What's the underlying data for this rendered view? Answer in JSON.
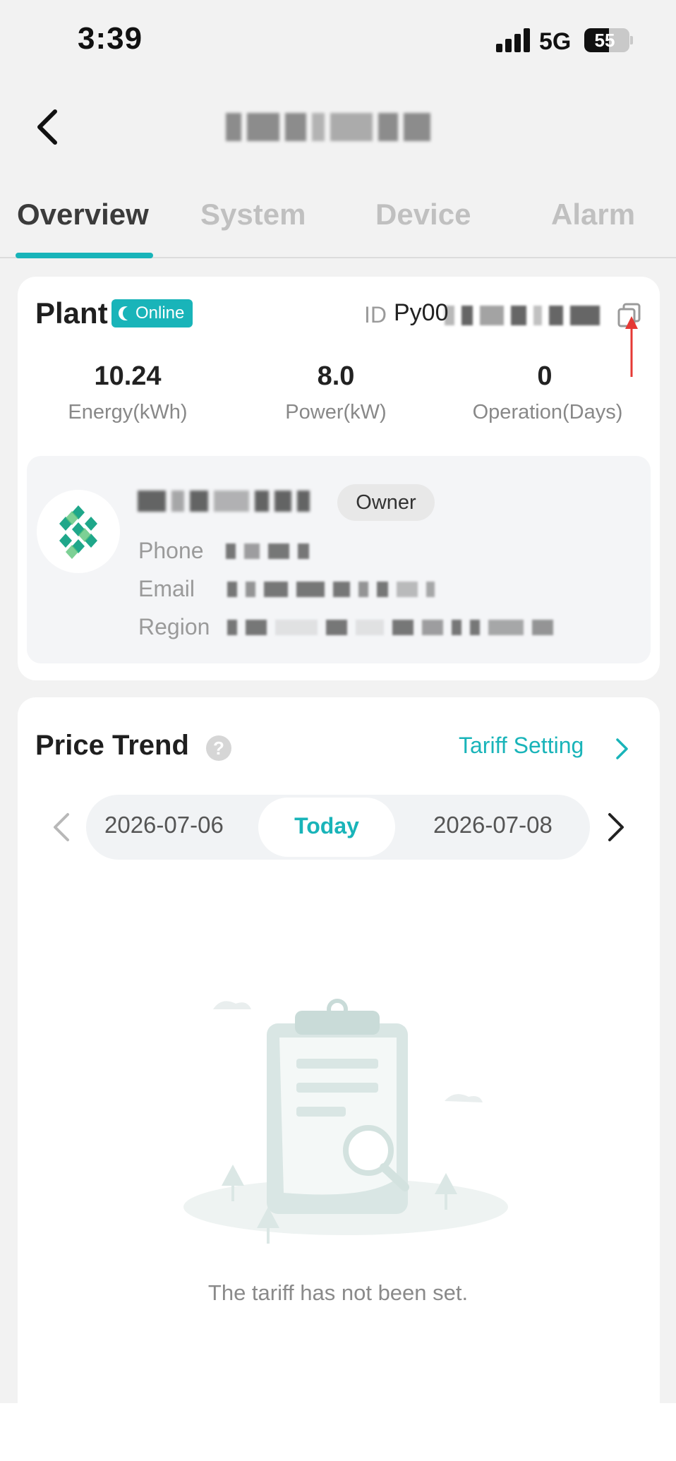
{
  "status_bar": {
    "time": "3:39",
    "network": "5G",
    "battery": "55",
    "battery_level_pct": 55
  },
  "header": {
    "back_icon": "chevron-left-icon"
  },
  "tabs": [
    {
      "label": "Overview",
      "active": true
    },
    {
      "label": "System",
      "active": false
    },
    {
      "label": "Device",
      "active": false
    },
    {
      "label": "Alarm",
      "active": false
    }
  ],
  "plant": {
    "title": "Plant",
    "status": "Online",
    "id_label": "ID",
    "id_prefix": "Py00",
    "copy_icon": "copy-icon",
    "stats": [
      {
        "value": "10.24",
        "label": "Energy(kWh)"
      },
      {
        "value": "8.0",
        "label": "Power(kW)"
      },
      {
        "value": "0",
        "label": "Operation(Days)"
      }
    ],
    "owner": {
      "role": "Owner",
      "phone_label": "Phone",
      "email_label": "Email",
      "region_label": "Region"
    }
  },
  "price_trend": {
    "title": "Price Trend",
    "help_icon": "question-icon",
    "tariff_link": "Tariff Setting",
    "dates": {
      "prev": "2026-07-06",
      "current": "Today",
      "next": "2026-07-08"
    },
    "empty_message": "The tariff has not been set."
  },
  "colors": {
    "accent": "#19b4b9",
    "background": "#f2f2f2",
    "annotation": "#e53935"
  }
}
